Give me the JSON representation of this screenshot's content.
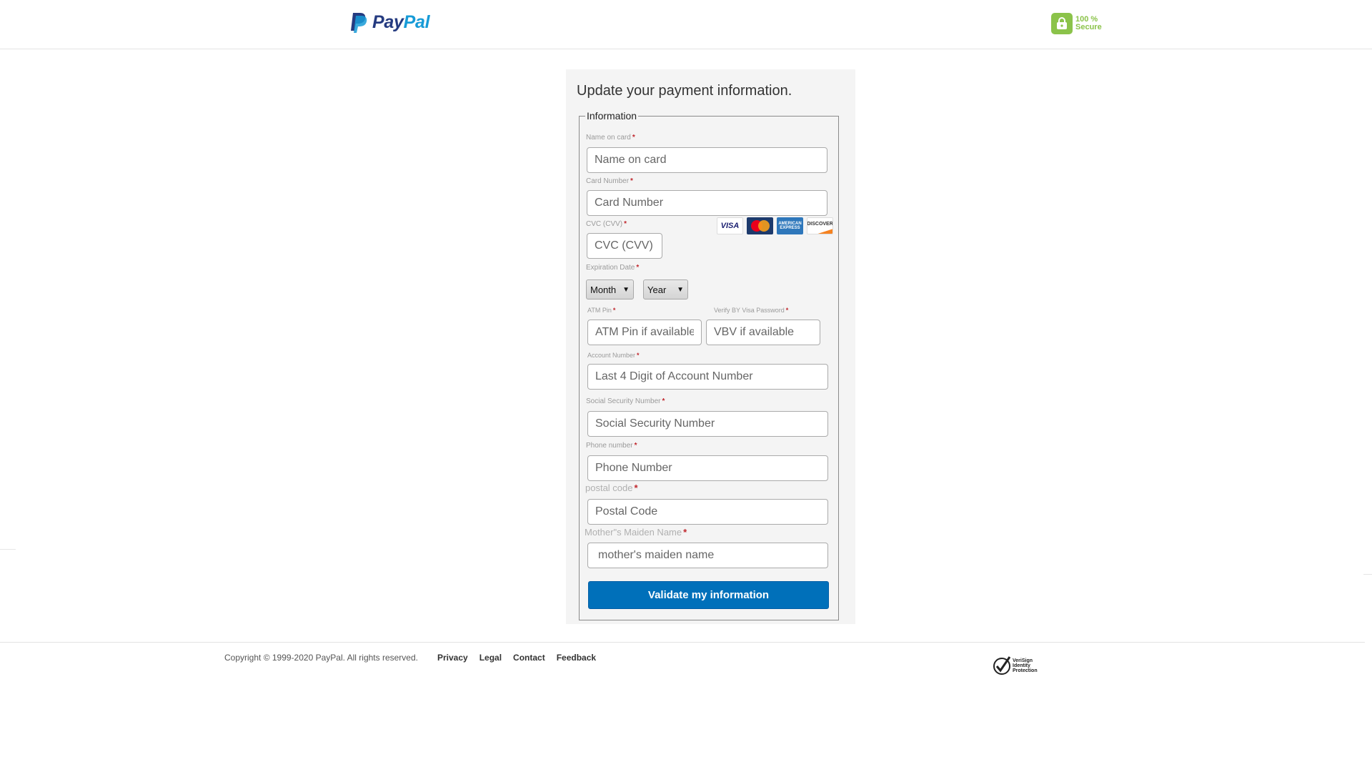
{
  "header": {
    "brand_pay": "Pay",
    "brand_pal": "Pal",
    "secure_line1": "100 %",
    "secure_line2": "Secure",
    "lock_icon": "lock-icon"
  },
  "form": {
    "title": "Update your payment information.",
    "legend": "Information",
    "name_label": "Name on card",
    "name_placeholder": "Name on card",
    "card_label": "Card Number",
    "card_placeholder": "Card Number",
    "cvc_label": "CVC (CVV)",
    "cvc_placeholder": "CVC (CVV)",
    "card_logos": [
      "VISA",
      "MasterCard",
      "AMERICAN EXPRESS",
      "DISCOVER"
    ],
    "exp_label": "Expiration Date",
    "month_value": "Month",
    "year_value": "Year",
    "atm_label": "ATM Pin",
    "atm_placeholder": "ATM Pin if available",
    "vbv_label": "Verify BY Visa Password",
    "vbv_placeholder": "VBV if available",
    "account_label": "Account Number",
    "account_placeholder": "Last 4 Digit of Account Number",
    "ssn_label": "Social Security Number",
    "ssn_placeholder": "Social Security Number",
    "phone_label": "Phone number",
    "phone_placeholder": "Phone Number",
    "postal_label": "postal code",
    "postal_placeholder": "Postal Code",
    "maiden_label": "Mother\"s Maiden Name",
    "maiden_placeholder": "mother's maiden name",
    "required_mark": "*",
    "submit_label": "Validate my information"
  },
  "footer": {
    "copyright": "Copyright © 1999-2020 PayPal. All rights reserved.",
    "links": [
      "Privacy",
      "Legal",
      "Contact",
      "Feedback"
    ],
    "verisign_lines": [
      "VeriSign",
      "Identity",
      "Protection"
    ]
  },
  "colors": {
    "primary_button": "#0070ba",
    "paypal_dark": "#253b80",
    "paypal_light": "#179bd7",
    "secure_green": "#8bc34a",
    "required_red": "#c0272d"
  }
}
